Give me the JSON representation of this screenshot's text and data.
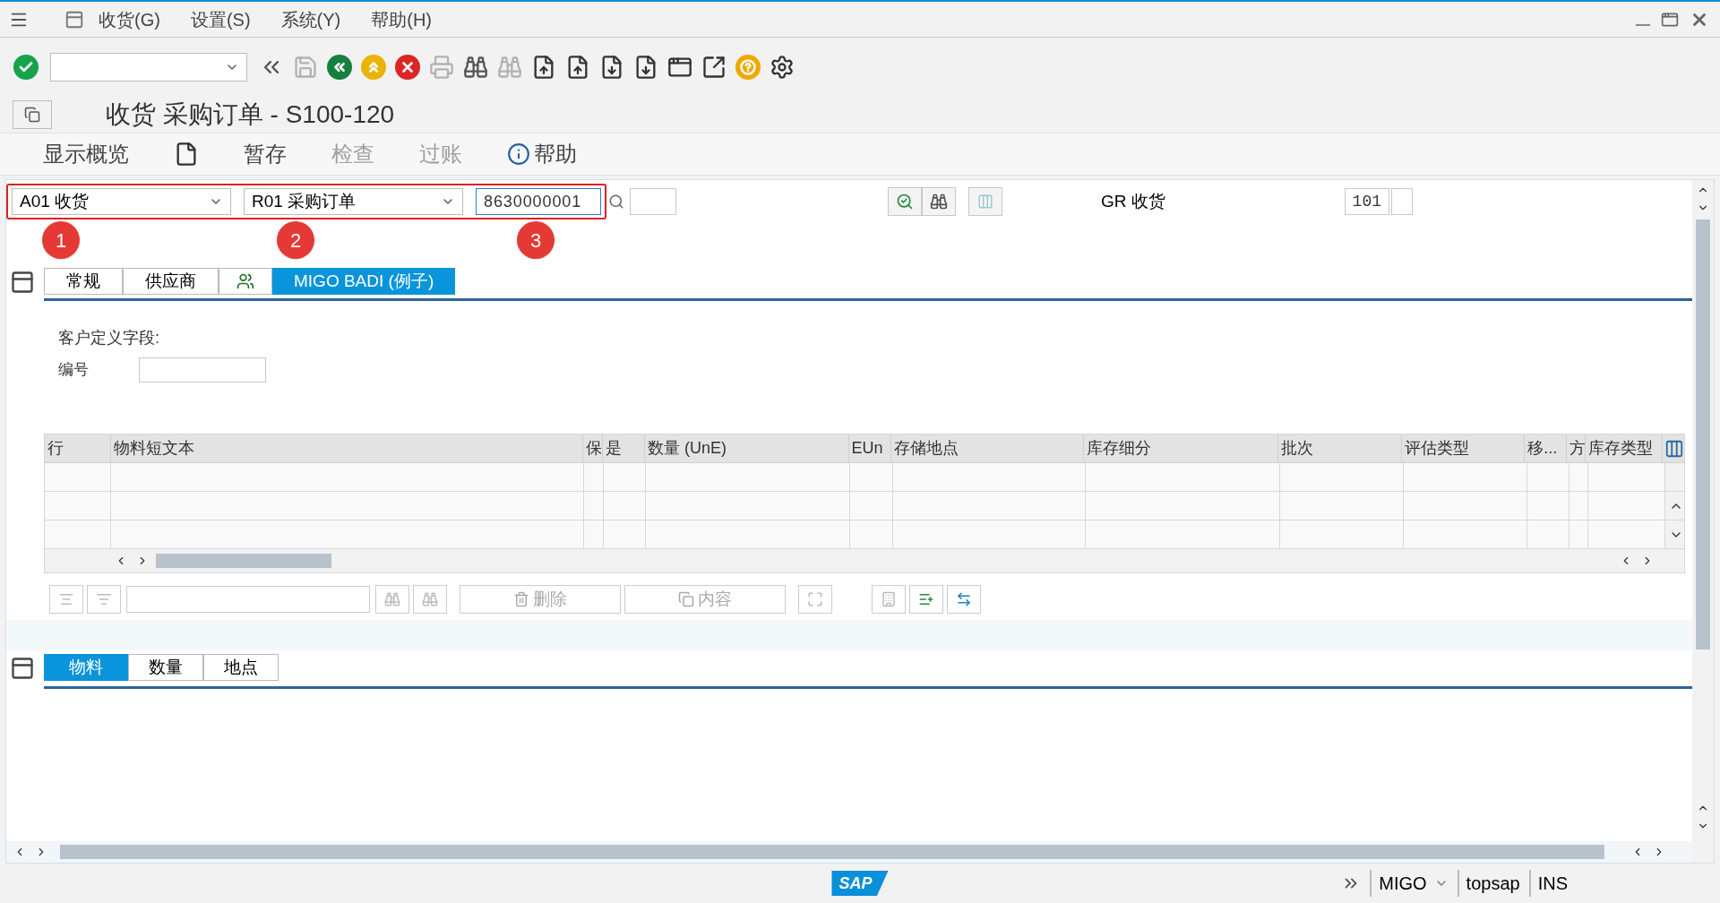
{
  "menu_bar": {
    "items": [
      {
        "label": "收货(G)"
      },
      {
        "label": "设置(S)"
      },
      {
        "label": "系统(Y)"
      },
      {
        "label": "帮助(H)"
      }
    ]
  },
  "toolbar": {
    "buttons": [
      {
        "kind": "enter",
        "disabled": false
      },
      {
        "kind": "command"
      },
      {
        "kind": "collapse",
        "disabled": false
      },
      {
        "kind": "save",
        "disabled": true
      },
      {
        "kind": "back",
        "disabled": false
      },
      {
        "kind": "exit",
        "disabled": false
      },
      {
        "kind": "cancel",
        "disabled": false
      },
      {
        "kind": "print",
        "disabled": true
      },
      {
        "kind": "find",
        "disabled": false
      },
      {
        "kind": "find-next",
        "disabled": true
      },
      {
        "kind": "first-page",
        "disabled": false
      },
      {
        "kind": "prev-page",
        "disabled": false
      },
      {
        "kind": "next-page",
        "disabled": false
      },
      {
        "kind": "last-page",
        "disabled": false
      },
      {
        "kind": "new-session",
        "disabled": false
      },
      {
        "kind": "shortcut",
        "disabled": false
      },
      {
        "kind": "help",
        "disabled": false
      },
      {
        "kind": "settings",
        "disabled": false
      }
    ]
  },
  "title": "收货 采购订单 - S100-120",
  "app_toolbar": [
    {
      "kind": "text",
      "label": "显示概览",
      "disabled": false
    },
    {
      "kind": "icon",
      "disabled": false
    },
    {
      "kind": "text",
      "label": "暂存",
      "disabled": false
    },
    {
      "kind": "text",
      "label": "检查",
      "disabled": true
    },
    {
      "kind": "text",
      "label": "过账",
      "disabled": true
    },
    {
      "kind": "info",
      "label": "帮助",
      "disabled": false
    }
  ],
  "header": {
    "action": "A01 收货",
    "reference": "R01 采购订单",
    "document": "8630000001",
    "movement_label": "GR 收货",
    "movement_type": "101"
  },
  "annotations": [
    {
      "label": "1"
    },
    {
      "label": "2"
    },
    {
      "label": "3"
    }
  ],
  "tabs": [
    {
      "kind": "text",
      "label": "常规",
      "selected": false
    },
    {
      "kind": "text",
      "label": "供应商",
      "selected": false
    },
    {
      "kind": "icon",
      "selected": false
    },
    {
      "kind": "text",
      "label": "MIGO BADI (例子)",
      "selected": true
    }
  ],
  "custom_fields": {
    "heading": "客户定义字段:",
    "label": "编号"
  },
  "table": {
    "columns": [
      "行",
      "物料短文本",
      "保",
      "是",
      "数量 (UnE)",
      "EUn",
      "存储地点",
      "库存细分",
      "批次",
      "评估类型",
      "移...",
      "方",
      "库存类型"
    ]
  },
  "table_toolbar": {
    "delete": {
      "label": "删除",
      "disabled": true
    },
    "contents": {
      "label": "内容",
      "disabled": true
    }
  },
  "item_tabs": [
    {
      "label": "物料",
      "selected": true
    },
    {
      "label": "数量",
      "selected": false
    },
    {
      "label": "地点",
      "selected": false
    }
  ],
  "status_bar": {
    "logo": "SAP",
    "transaction": "MIGO",
    "server": "topsap",
    "mode": "INS"
  }
}
